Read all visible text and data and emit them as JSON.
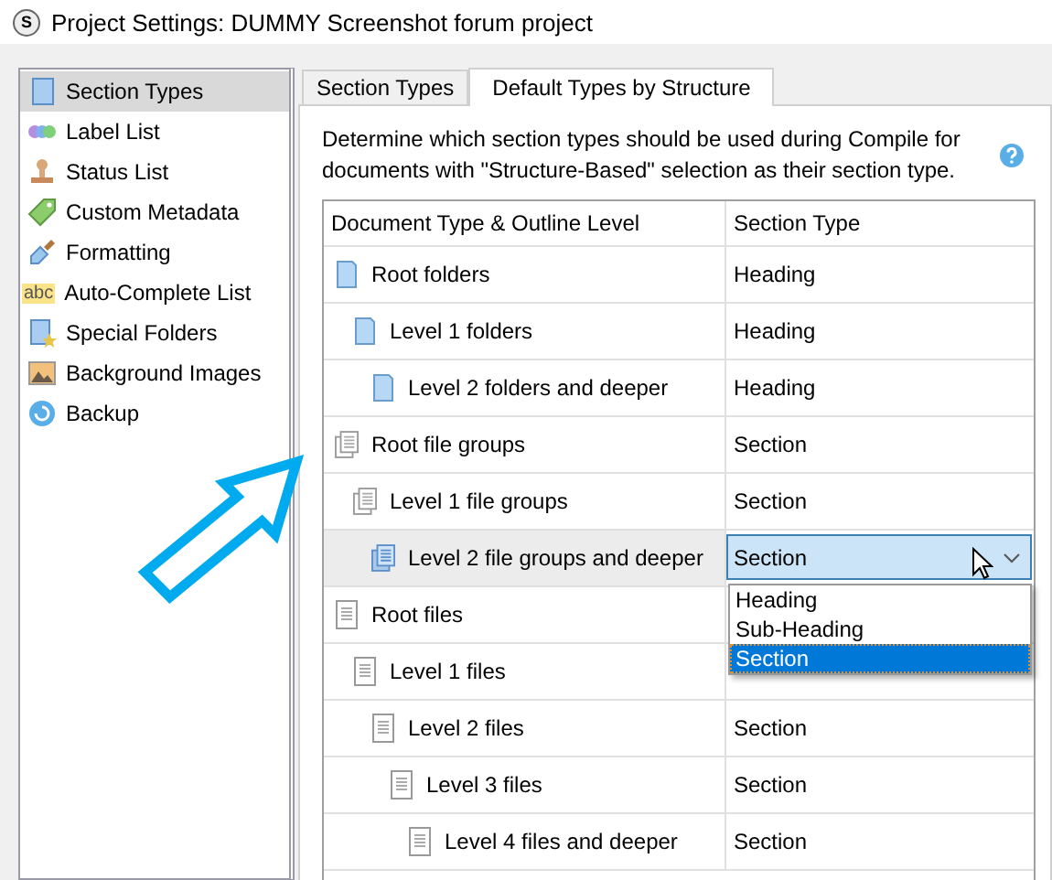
{
  "window": {
    "title": "Project Settings: DUMMY Screenshot forum project",
    "icon_text": "S"
  },
  "sidebar": {
    "items": [
      {
        "label": "Section Types",
        "kind": "section-types",
        "selected": true
      },
      {
        "label": "Label List",
        "kind": "labels",
        "selected": false
      },
      {
        "label": "Status List",
        "kind": "stamp",
        "selected": false
      },
      {
        "label": "Custom Metadata",
        "kind": "tag",
        "selected": false
      },
      {
        "label": "Formatting",
        "kind": "brush",
        "selected": false
      },
      {
        "label": "Auto-Complete List",
        "kind": "abc",
        "icon_text": "abc",
        "selected": false
      },
      {
        "label": "Special Folders",
        "kind": "star-folder",
        "selected": false
      },
      {
        "label": "Background Images",
        "kind": "image",
        "selected": false
      },
      {
        "label": "Backup",
        "kind": "backup",
        "selected": false
      }
    ]
  },
  "tabs": [
    {
      "label": "Section Types",
      "selected": false
    },
    {
      "label": "Default Types by Structure",
      "selected": true
    }
  ],
  "description": "Determine which section types should be used during Compile for documents with \"Structure-Based\" selection as their section type.",
  "table": {
    "columns": [
      "Document Type & Outline Level",
      "Section Type"
    ],
    "rows": [
      {
        "label": "Root folders",
        "kind": "folder",
        "section_type": "Heading",
        "selected": false,
        "children": [
          {
            "label": "Level 1 folders",
            "kind": "folder",
            "section_type": "Heading",
            "selected": false,
            "children": [
              {
                "label": "Level 2 folders and deeper",
                "kind": "folder",
                "section_type": "Heading",
                "selected": false
              }
            ]
          }
        ]
      },
      {
        "label": "Root file groups",
        "kind": "file-group",
        "section_type": "Section",
        "selected": false,
        "children": [
          {
            "label": "Level 1 file groups",
            "kind": "file-group",
            "section_type": "Section",
            "selected": false,
            "children": [
              {
                "label": "Level 2 file groups and deeper",
                "kind": "file-group",
                "section_type": "Section",
                "selected": true,
                "dropdown": {
                  "expanded": true,
                  "options": [
                    {
                      "label": "Heading",
                      "selected": false
                    },
                    {
                      "label": "Sub-Heading",
                      "selected": false
                    },
                    {
                      "label": "Section",
                      "selected": true
                    }
                  ]
                }
              }
            ]
          }
        ]
      },
      {
        "label": "Root files",
        "kind": "file",
        "selected": false,
        "children": [
          {
            "label": "Level 1 files",
            "kind": "file",
            "selected": false,
            "children": [
              {
                "label": "Level 2 files",
                "kind": "file",
                "section_type": "Section",
                "selected": false,
                "children": [
                  {
                    "label": "Level 3 files",
                    "kind": "file",
                    "section_type": "Section",
                    "selected": false,
                    "children": [
                      {
                        "label": "Level 4 files and deeper",
                        "kind": "file",
                        "section_type": "Section",
                        "selected": false
                      }
                    ]
                  }
                ]
              }
            ]
          }
        ]
      }
    ]
  }
}
